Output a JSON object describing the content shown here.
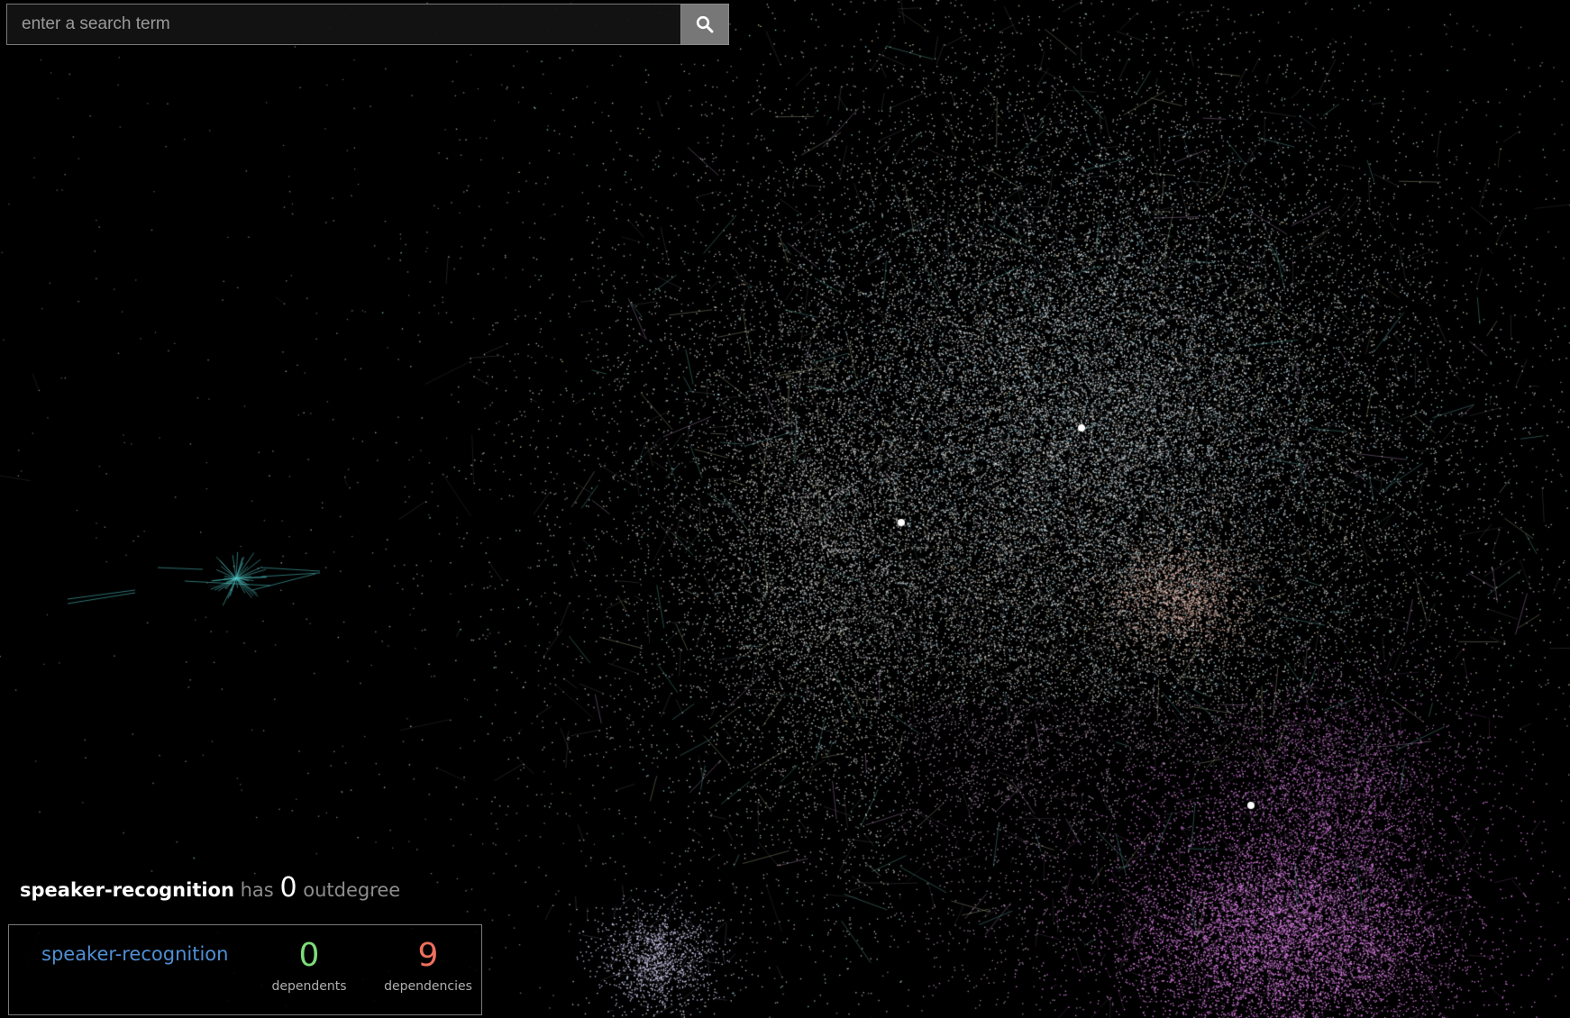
{
  "search": {
    "placeholder": "enter a search term",
    "value": "",
    "button_icon": "search-icon"
  },
  "selection": {
    "package": "speaker-recognition",
    "has_label": "has",
    "outdegree": "0",
    "outdegree_label": "outdegree"
  },
  "info_box": {
    "package": "speaker-recognition",
    "dependents_value": "0",
    "dependents_label": "dependents",
    "dependencies_value": "9",
    "dependencies_label": "dependencies"
  },
  "colors": {
    "background": "#000000",
    "dependents": "#7ddc7a",
    "dependencies": "#ee6f5e",
    "package_link": "#4f8fd4"
  }
}
